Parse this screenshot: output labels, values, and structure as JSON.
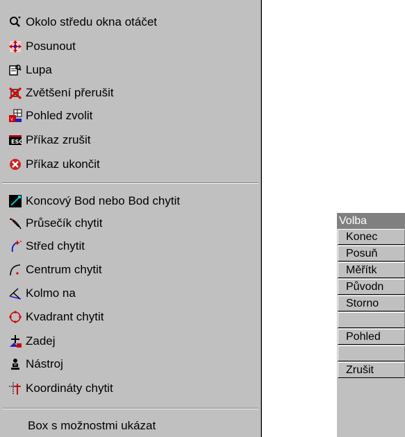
{
  "menu": {
    "group1": [
      {
        "label": "Okolo středu okna otáčet",
        "icon": "rotate-magnifier-icon"
      },
      {
        "label": "Posunout",
        "icon": "pan-icon"
      },
      {
        "label": "Lupa",
        "icon": "zoom-icon"
      },
      {
        "label": "Zvětšení přerušit",
        "icon": "cancel-zoom-icon"
      },
      {
        "label": "Pohled zvolit",
        "icon": "view-select-icon"
      },
      {
        "label": "Příkaz zrušit",
        "icon": "cancel-command-icon"
      },
      {
        "label": "Příkaz ukončit",
        "icon": "end-command-icon"
      }
    ],
    "group2": [
      {
        "label": "Koncový Bod nebo Bod chytit",
        "icon": "endpoint-snap-icon"
      },
      {
        "label": "Průsečík chytit",
        "icon": "intersection-snap-icon"
      },
      {
        "label": "Střed chytit",
        "icon": "midpoint-snap-icon"
      },
      {
        "label": "Centrum chytit",
        "icon": "center-snap-icon"
      },
      {
        "label": "Kolmo na",
        "icon": "perpendicular-snap-icon"
      },
      {
        "label": "Kvadrant chytit",
        "icon": "quadrant-snap-icon"
      },
      {
        "label": "Zadej",
        "icon": "enter-point-icon"
      },
      {
        "label": "Nástroj",
        "icon": "tool-icon"
      },
      {
        "label": "Koordináty chytit",
        "icon": "coordinates-snap-icon"
      }
    ],
    "group3": [
      {
        "label": "Box s možnostmi ukázat"
      }
    ]
  },
  "panel": {
    "title": "Volba",
    "buttons": [
      "Konec",
      "Posuň",
      "Měřítk",
      "Původn",
      "Storno",
      "",
      "Pohled",
      "",
      "Zrušit"
    ]
  },
  "colors": {
    "face": "#c0c0c0",
    "shadow": "#808080",
    "highlight": "#ffffff"
  }
}
